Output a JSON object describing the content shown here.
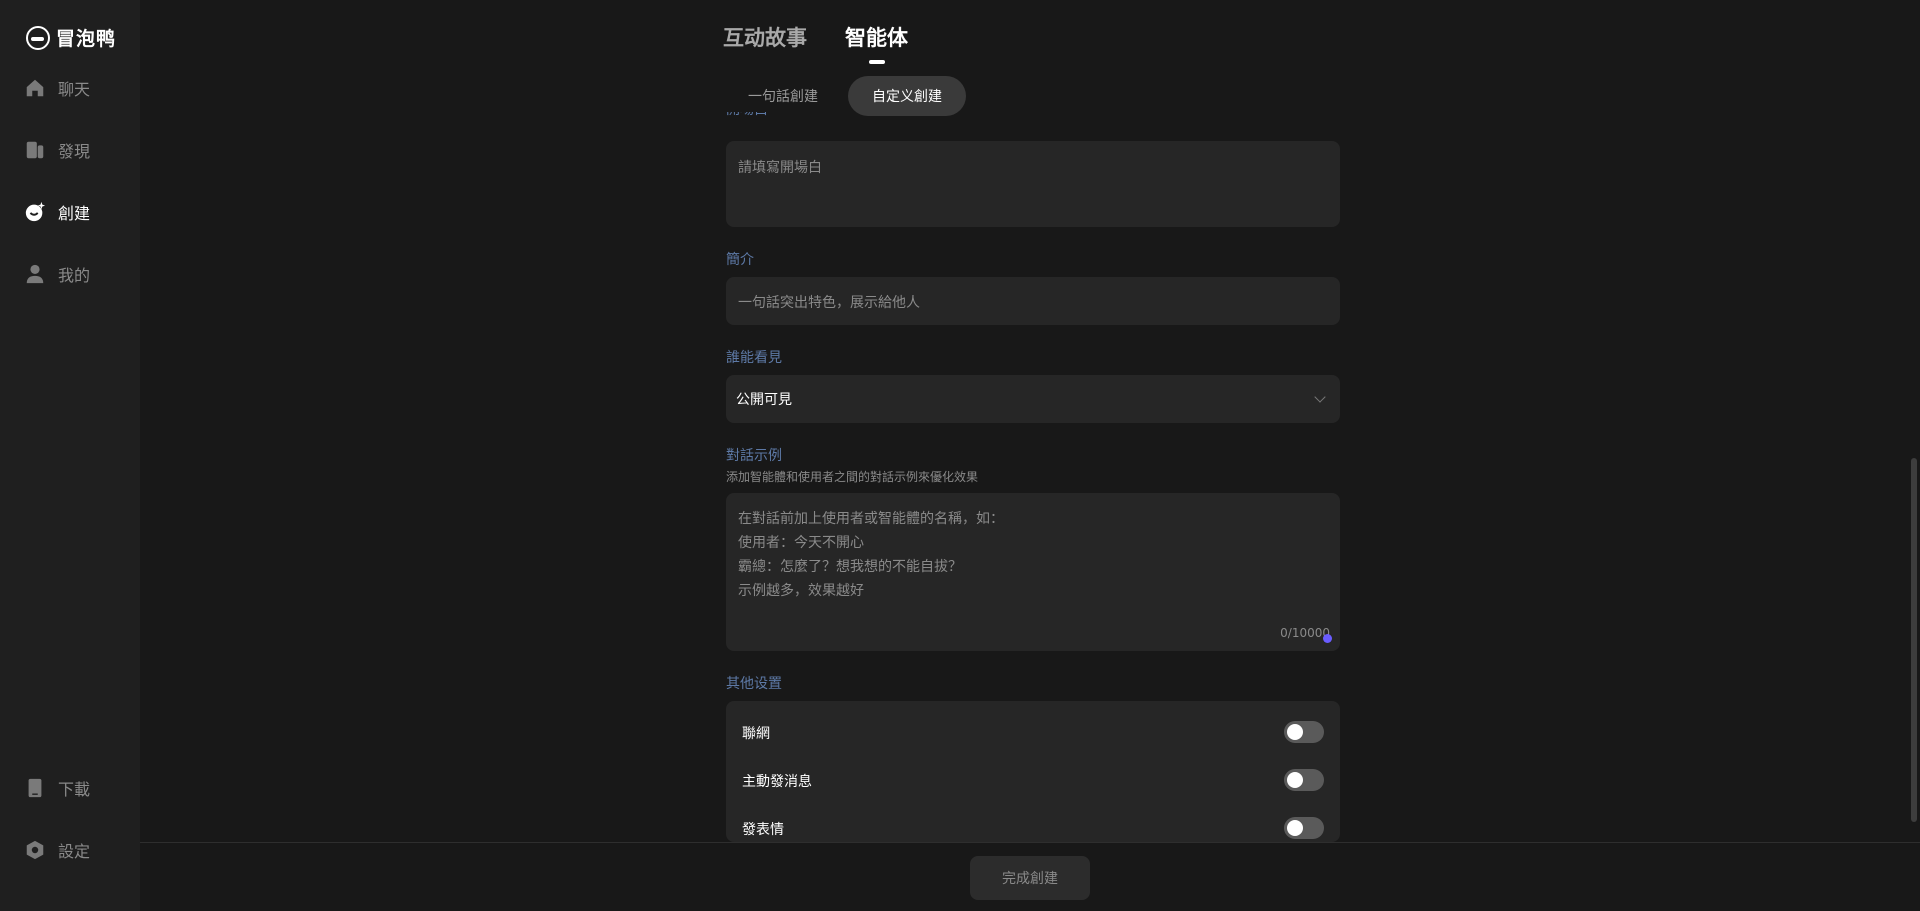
{
  "app": {
    "name": "冒泡鸭"
  },
  "sidebar": {
    "items": [
      {
        "label": "聊天",
        "icon": "home-icon"
      },
      {
        "label": "發現",
        "icon": "discover-icon"
      },
      {
        "label": "創建",
        "icon": "create-icon",
        "active": true
      },
      {
        "label": "我的",
        "icon": "user-icon"
      }
    ],
    "bottom_items": [
      {
        "label": "下載",
        "icon": "phone-icon"
      },
      {
        "label": "設定",
        "icon": "settings-icon"
      }
    ]
  },
  "header": {
    "tabs": [
      {
        "label": "互动故事",
        "active": false
      },
      {
        "label": "智能体",
        "active": true
      }
    ],
    "subtabs": [
      {
        "label": "一句話創建",
        "active": false
      },
      {
        "label": "自定义創建",
        "active": true
      }
    ]
  },
  "form": {
    "opening": {
      "label": "開場白",
      "placeholder": "請填寫開場白"
    },
    "intro": {
      "label": "簡介",
      "placeholder": "一句話突出特色，展示給他人"
    },
    "visibility": {
      "label": "誰能看見",
      "value": "公開可見"
    },
    "dialog_example": {
      "label": "對話示例",
      "hint": "添加智能體和使用者之間的對話示例來優化效果",
      "placeholder_lines": [
        "在對話前加上使用者或智能體的名稱，如：",
        "使用者：今天不開心",
        "霸總：怎麼了？想我想的不能自拔？",
        "示例越多，效果越好"
      ],
      "counter": "0/10000"
    },
    "other_settings": {
      "label": "其他设置",
      "toggles": [
        {
          "label": "聯網",
          "on": false
        },
        {
          "label": "主動發消息",
          "on": false
        },
        {
          "label": "發表情",
          "on": false
        }
      ]
    }
  },
  "footer": {
    "finish_label": "完成創建"
  },
  "colors": {
    "background": "#181818",
    "sidebar": "#1f1f1f",
    "field": "#262626",
    "label": "#5d79a6",
    "accent_dot": "#6a5cff"
  }
}
